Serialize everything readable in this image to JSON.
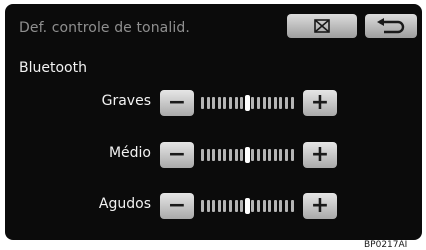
{
  "screen": {
    "title": "Def. controle de tonalid.",
    "section_label": "Bluetooth"
  },
  "buttons": {
    "close_icon": "close-box-icon",
    "back_icon": "return-arrow-icon"
  },
  "tone_controls": [
    {
      "label": "Graves",
      "level": 0.5,
      "minus_label": "−",
      "plus_label": "+"
    },
    {
      "label": "Médio",
      "level": 0.5,
      "minus_label": "−",
      "plus_label": "+"
    },
    {
      "label": "Agudos",
      "level": 0.5,
      "minus_label": "−",
      "plus_label": "+"
    }
  ],
  "figure_code": "BP0217AI"
}
